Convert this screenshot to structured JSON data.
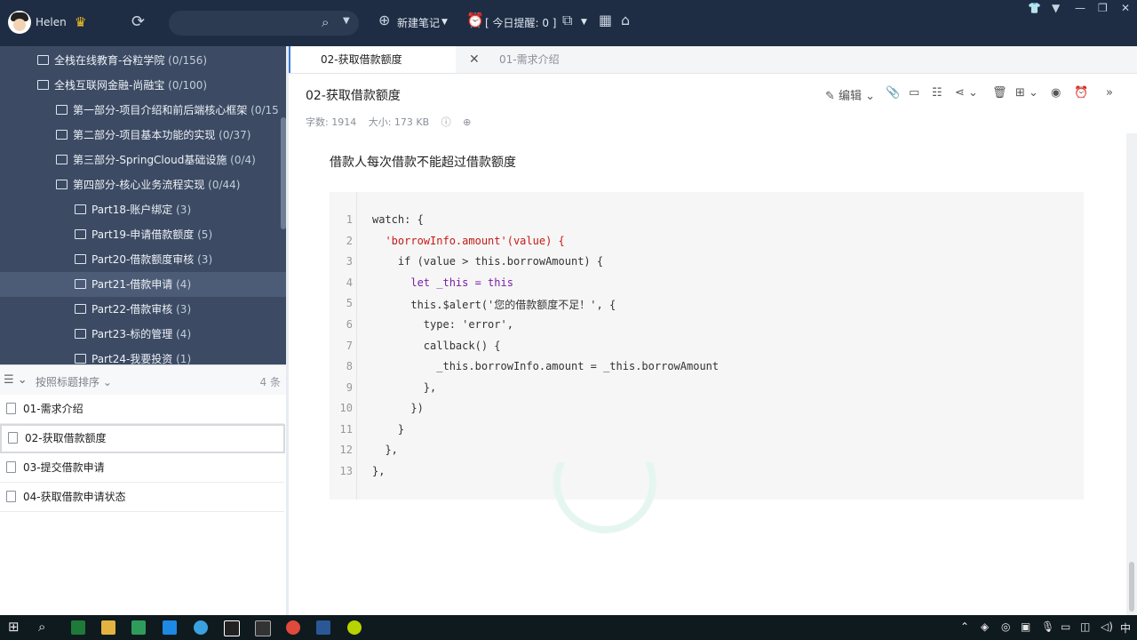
{
  "user": {
    "name": "Helen"
  },
  "search": {
    "placeholder": ""
  },
  "toolbar": {
    "new_note": "新建笔记",
    "reminder": "[ 今日提醒: 0 ]"
  },
  "tree": [
    {
      "label": "全栈在线教育-谷粒学院",
      "count": "(0/156)"
    },
    {
      "label": "全栈互联网金融-尚融宝",
      "count": "(0/100)"
    },
    {
      "label": "第一部分-项目介绍和前后端核心框架",
      "count": "(0/15"
    },
    {
      "label": "第二部分-项目基本功能的实现",
      "count": "(0/37)"
    },
    {
      "label": "第三部分-SpringCloud基础设施",
      "count": "(0/4)"
    },
    {
      "label": "第四部分-核心业务流程实现",
      "count": "(0/44)"
    },
    {
      "label": "Part18-账户绑定",
      "count": "(3)"
    },
    {
      "label": "Part19-申请借款额度",
      "count": "(5)"
    },
    {
      "label": "Part20-借款额度审核",
      "count": "(3)"
    },
    {
      "label": "Part21-借款申请",
      "count": "(4)"
    },
    {
      "label": "Part22-借款审核",
      "count": "(3)"
    },
    {
      "label": "Part23-标的管理",
      "count": "(4)"
    },
    {
      "label": "Part24-我要投资",
      "count": "(1)"
    }
  ],
  "sort": {
    "label": "按照标题排序",
    "count": "4 条"
  },
  "notes": [
    {
      "title": "01-需求介绍"
    },
    {
      "title": "02-获取借款额度"
    },
    {
      "title": "03-提交借款申请"
    },
    {
      "title": "04-获取借款申请状态"
    }
  ],
  "tabs": [
    {
      "label": "02-获取借款额度"
    },
    {
      "label": "01-需求介绍"
    }
  ],
  "doc": {
    "title": "02-获取借款额度",
    "edit_label": "编辑",
    "word_count": "字数: 1914",
    "size": "大小: 173 KB",
    "paragraph": "借款人每次借款不能超过借款额度"
  },
  "code": {
    "line_numbers": [
      "1",
      "2",
      "3",
      "4",
      "5",
      "6",
      "7",
      "8",
      "9",
      "10",
      "11",
      "12",
      "13"
    ],
    "lines": [
      "watch: {",
      "  'borrowInfo.amount'(value) {",
      "    if (value > this.borrowAmount) {",
      "      let _this = this",
      "      this.$alert('您的借款额度不足！', {",
      "        type: 'error',",
      "        callback() {",
      "          _this.borrowInfo.amount = _this.borrowAmount",
      "        },",
      "      })",
      "    }",
      "  },",
      "},"
    ]
  },
  "taskbar": {
    "ime": "中"
  },
  "colors": {
    "topbar": "#1f2d44",
    "sidebar": "#3c4a63",
    "accent": "#3a7bd5"
  }
}
